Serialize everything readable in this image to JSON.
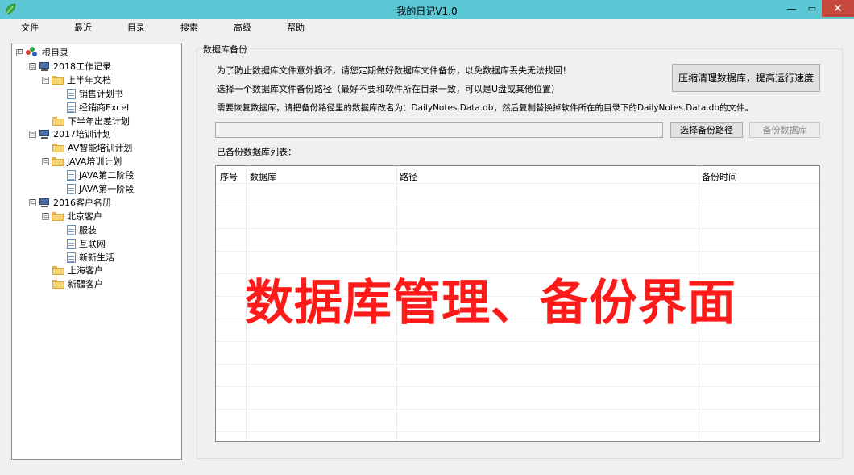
{
  "window": {
    "title": "我的日记V1.0",
    "min_glyph": "—",
    "max_glyph": "▭",
    "close_glyph": "✕"
  },
  "menu": [
    "文件",
    "最近",
    "目录",
    "搜索",
    "高级",
    "帮助"
  ],
  "tree": [
    {
      "label": "根目录",
      "icon": "root-icon",
      "expander": "⊟"
    },
    {
      "label": "2018工作记录",
      "icon": "computer-icon",
      "expander": "⊟"
    },
    {
      "label": "上半年文档",
      "icon": "folder-icon",
      "expander": "⊟"
    },
    {
      "label": "销售计划书",
      "icon": "document-icon",
      "expander": ""
    },
    {
      "label": "经销商Excel",
      "icon": "document-icon",
      "expander": ""
    },
    {
      "label": "下半年出差计划",
      "icon": "folder-icon",
      "expander": ""
    },
    {
      "label": "2017培训计划",
      "icon": "computer-icon",
      "expander": "⊟"
    },
    {
      "label": "AV智能培训计划",
      "icon": "folder-icon",
      "expander": ""
    },
    {
      "label": "JAVA培训计划",
      "icon": "folder-icon",
      "expander": "⊟"
    },
    {
      "label": "JAVA第二阶段",
      "icon": "document-icon",
      "expander": ""
    },
    {
      "label": "JAVA第一阶段",
      "icon": "document-icon",
      "expander": ""
    },
    {
      "label": "2016客户名册",
      "icon": "computer-icon",
      "expander": "⊟"
    },
    {
      "label": "北京客户",
      "icon": "folder-icon",
      "expander": "⊟"
    },
    {
      "label": "服装",
      "icon": "document-icon",
      "expander": ""
    },
    {
      "label": "互联网",
      "icon": "document-icon",
      "expander": ""
    },
    {
      "label": "新新生活",
      "icon": "document-icon",
      "expander": ""
    },
    {
      "label": "上海客户",
      "icon": "folder-icon",
      "expander": ""
    },
    {
      "label": "新疆客户",
      "icon": "folder-icon",
      "expander": ""
    }
  ],
  "backup": {
    "group_title": "数据库备份",
    "info1": "为了防止数据库文件意外损坏，请您定期做好数据库文件备份，以免数据库丢失无法找回！",
    "info2": "选择一个数据库文件备份路径（最好不要和软件所在目录一致，可以是U盘或其他位置）",
    "info3": "需要恢复数据库，请把备份路径里的数据库改名为：DailyNotes.Data.db，然后复制替换掉软件所在的目录下的DailyNotes.Data.db的文件。",
    "compress_button": "压缩清理数据库，提高运行速度",
    "path_value": "",
    "choose_button": "选择备份路径",
    "backup_button": "备份数据库",
    "list_label": "已备份数据库列表：",
    "columns": [
      "序号",
      "数据库",
      "路径",
      "备份时间"
    ]
  },
  "watermark": "数据库管理、备份界面",
  "colors": {
    "titlebar": "#5cc8d6",
    "close": "#c7483c",
    "watermark": "#ff1a1a"
  }
}
